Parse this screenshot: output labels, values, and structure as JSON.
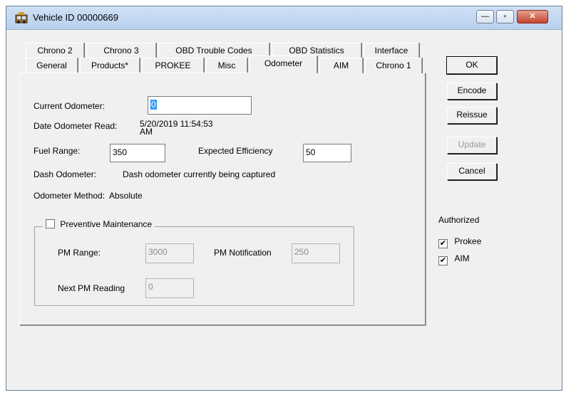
{
  "window": {
    "title": "Vehicle ID 00000669",
    "controls": [
      "—",
      "▫",
      "✕"
    ]
  },
  "tabs": {
    "row_back": [
      "Chrono 2",
      "Chrono 3",
      "OBD Trouble Codes",
      "OBD Statistics",
      "Interface"
    ],
    "row_front": [
      "General",
      "Products*",
      "PROKEE",
      "Misc",
      "Odometer",
      "AIM",
      "Chrono 1"
    ],
    "active": "Odometer"
  },
  "odometer": {
    "current_label": "Current Odometer:",
    "current_value": "0",
    "date_label": "Date Odometer Read:",
    "date_value_line1": "5/20/2019 11:54:53",
    "date_value_line2": "AM",
    "fuel_range_label": "Fuel Range:",
    "fuel_range_value": "350",
    "expected_eff_label": "Expected Efficiency",
    "expected_eff_value": "50",
    "dash_label": "Dash Odometer:",
    "dash_value": "Dash odometer currently being captured",
    "method_label": "Odometer Method:",
    "method_value": "Absolute"
  },
  "pm": {
    "title": "Preventive Maintenance",
    "checked": false,
    "range_label": "PM Range:",
    "range_value": "3000",
    "notification_label": "PM Notification",
    "notification_value": "250",
    "next_label": "Next PM Reading",
    "next_value": "0"
  },
  "buttons": {
    "ok": "OK",
    "encode": "Encode",
    "reissue": "Reissue",
    "update": "Update",
    "cancel": "Cancel"
  },
  "authorized": {
    "title": "Authorized",
    "items": [
      {
        "label": "Prokee",
        "checked": true
      },
      {
        "label": "AIM",
        "checked": true
      }
    ]
  }
}
